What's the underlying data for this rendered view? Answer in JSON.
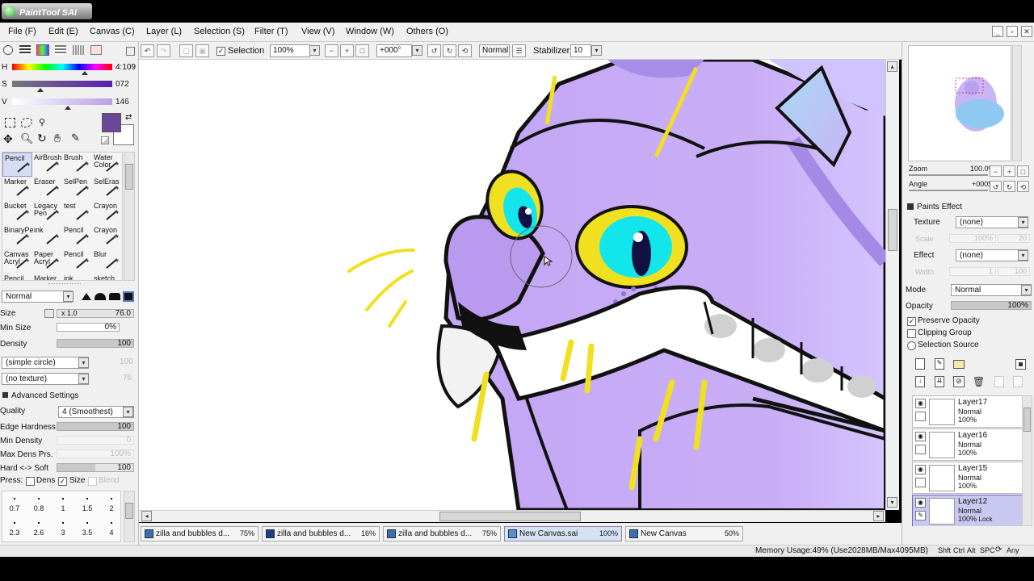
{
  "app": {
    "title": "PaintTool SAI"
  },
  "menu": [
    "File (F)",
    "Edit (E)",
    "Canvas (C)",
    "Layer (L)",
    "Selection (S)",
    "Filter (T)",
    "View (V)",
    "Window (W)",
    "Others (O)"
  ],
  "color": {
    "h_label": "H",
    "h_value": "4:109",
    "s_label": "S",
    "s_value": "072",
    "v_label": "V",
    "v_value": "146",
    "current_color": "#6a4a98"
  },
  "tools": [
    {
      "label": "Pencil"
    },
    {
      "label": "AirBrush"
    },
    {
      "label": "Brush"
    },
    {
      "label": "Water Color"
    },
    {
      "label": "Marker"
    },
    {
      "label": "Eraser"
    },
    {
      "label": "SelPen"
    },
    {
      "label": "SelEras"
    },
    {
      "label": "Bucket"
    },
    {
      "label": "Legacy Pen"
    },
    {
      "label": "test"
    },
    {
      "label": "Crayon"
    },
    {
      "label": "BinaryPe"
    },
    {
      "label": "ink"
    },
    {
      "label": "Pencil"
    },
    {
      "label": "Crayon"
    },
    {
      "label": "Canvas Acryl"
    },
    {
      "label": "Paper Acryl"
    },
    {
      "label": "Pencil"
    },
    {
      "label": "Blur"
    },
    {
      "label": "Pencil"
    },
    {
      "label": "Marker"
    },
    {
      "label": "ink"
    },
    {
      "label": "sketch"
    }
  ],
  "brush": {
    "blend_mode": "Normal",
    "size_label": "Size",
    "size_mult": "x 1.0",
    "size_value": "76.0",
    "min_size_label": "Min Size",
    "min_size_value": "0%",
    "density_label": "Density",
    "density_value": "100",
    "shape": "(simple circle)",
    "shape_value": "100",
    "texture": "(no texture)",
    "texture_value": "76",
    "advanced_label": "Advanced Settings",
    "quality_label": "Quality",
    "quality_value": "4 (Smoothest)",
    "edge_label": "Edge Hardness",
    "edge_value": "100",
    "min_density_label": "Min Density",
    "min_density_value": "0",
    "max_dens_label": "Max Dens Prs.",
    "max_dens_value": "100%",
    "hardsoft_label": "Hard <-> Soft",
    "hardsoft_value": "100",
    "press_label": "Press:",
    "dens_label": "Dens",
    "size_chk_label": "Size",
    "blend_label": "Blend",
    "sizes_row1": [
      "0.7",
      "0.8",
      "1",
      "1.5",
      "2"
    ],
    "sizes_row2": [
      "2.3",
      "2.6",
      "3",
      "3.5",
      "4"
    ]
  },
  "toolbar": {
    "selection_label": "Selection",
    "zoom": "100%",
    "angle": "+000°",
    "mode": "Normal",
    "stabilizer_label": "Stabilizer",
    "stabilizer_value": "10"
  },
  "tabs": [
    {
      "name": "zilla and bubbles d...",
      "zoom": "75%"
    },
    {
      "name": "zilla and bubbles d...",
      "zoom": "16%"
    },
    {
      "name": "zilla and bubbles d...",
      "zoom": "75%"
    },
    {
      "name": "New Canvas.sai",
      "zoom": "100%"
    },
    {
      "name": "New Canvas",
      "zoom": "50%"
    }
  ],
  "status": {
    "memory": "Memory Usage:49% (Use2028MB/Max4095MB)",
    "keys": [
      "Shft",
      "Ctrl",
      "Alt",
      "SPC",
      "⟳",
      "Any"
    ]
  },
  "navigator": {
    "zoom_label": "Zoom",
    "zoom_value": "100.0%",
    "angle_label": "Angle",
    "angle_value": "+000$"
  },
  "layer_props": {
    "paints_effect_label": "Paints Effect",
    "texture_label": "Texture",
    "texture_value": "(none)",
    "scale_label": "Scale",
    "scale_value": "100%",
    "scale_value2": "20",
    "effect_label": "Effect",
    "effect_value": "(none)",
    "width_label": "Width",
    "width_value": "1",
    "width_value2": "100",
    "mode_label": "Mode",
    "mode_value": "Normal",
    "opacity_label": "Opacity",
    "opacity_value": "100%",
    "preserve_opacity": "Preserve Opacity",
    "clipping_group": "Clipping Group",
    "selection_source": "Selection Source"
  },
  "layers": [
    {
      "name": "Layer17",
      "mode": "Normal",
      "opacity": "100%",
      "lock": ""
    },
    {
      "name": "Layer16",
      "mode": "Normal",
      "opacity": "100%",
      "lock": ""
    },
    {
      "name": "Layer15",
      "mode": "Normal",
      "opacity": "100%",
      "lock": ""
    },
    {
      "name": "Layer12",
      "mode": "Normal",
      "opacity": "100%",
      "lock": "Lock"
    }
  ],
  "colors": {
    "selected_layer": "#c8c8f0",
    "canvas_purple": "#c4a8f4",
    "eye_cyan": "#12e6ea",
    "eye_yellow": "#f0e020"
  }
}
